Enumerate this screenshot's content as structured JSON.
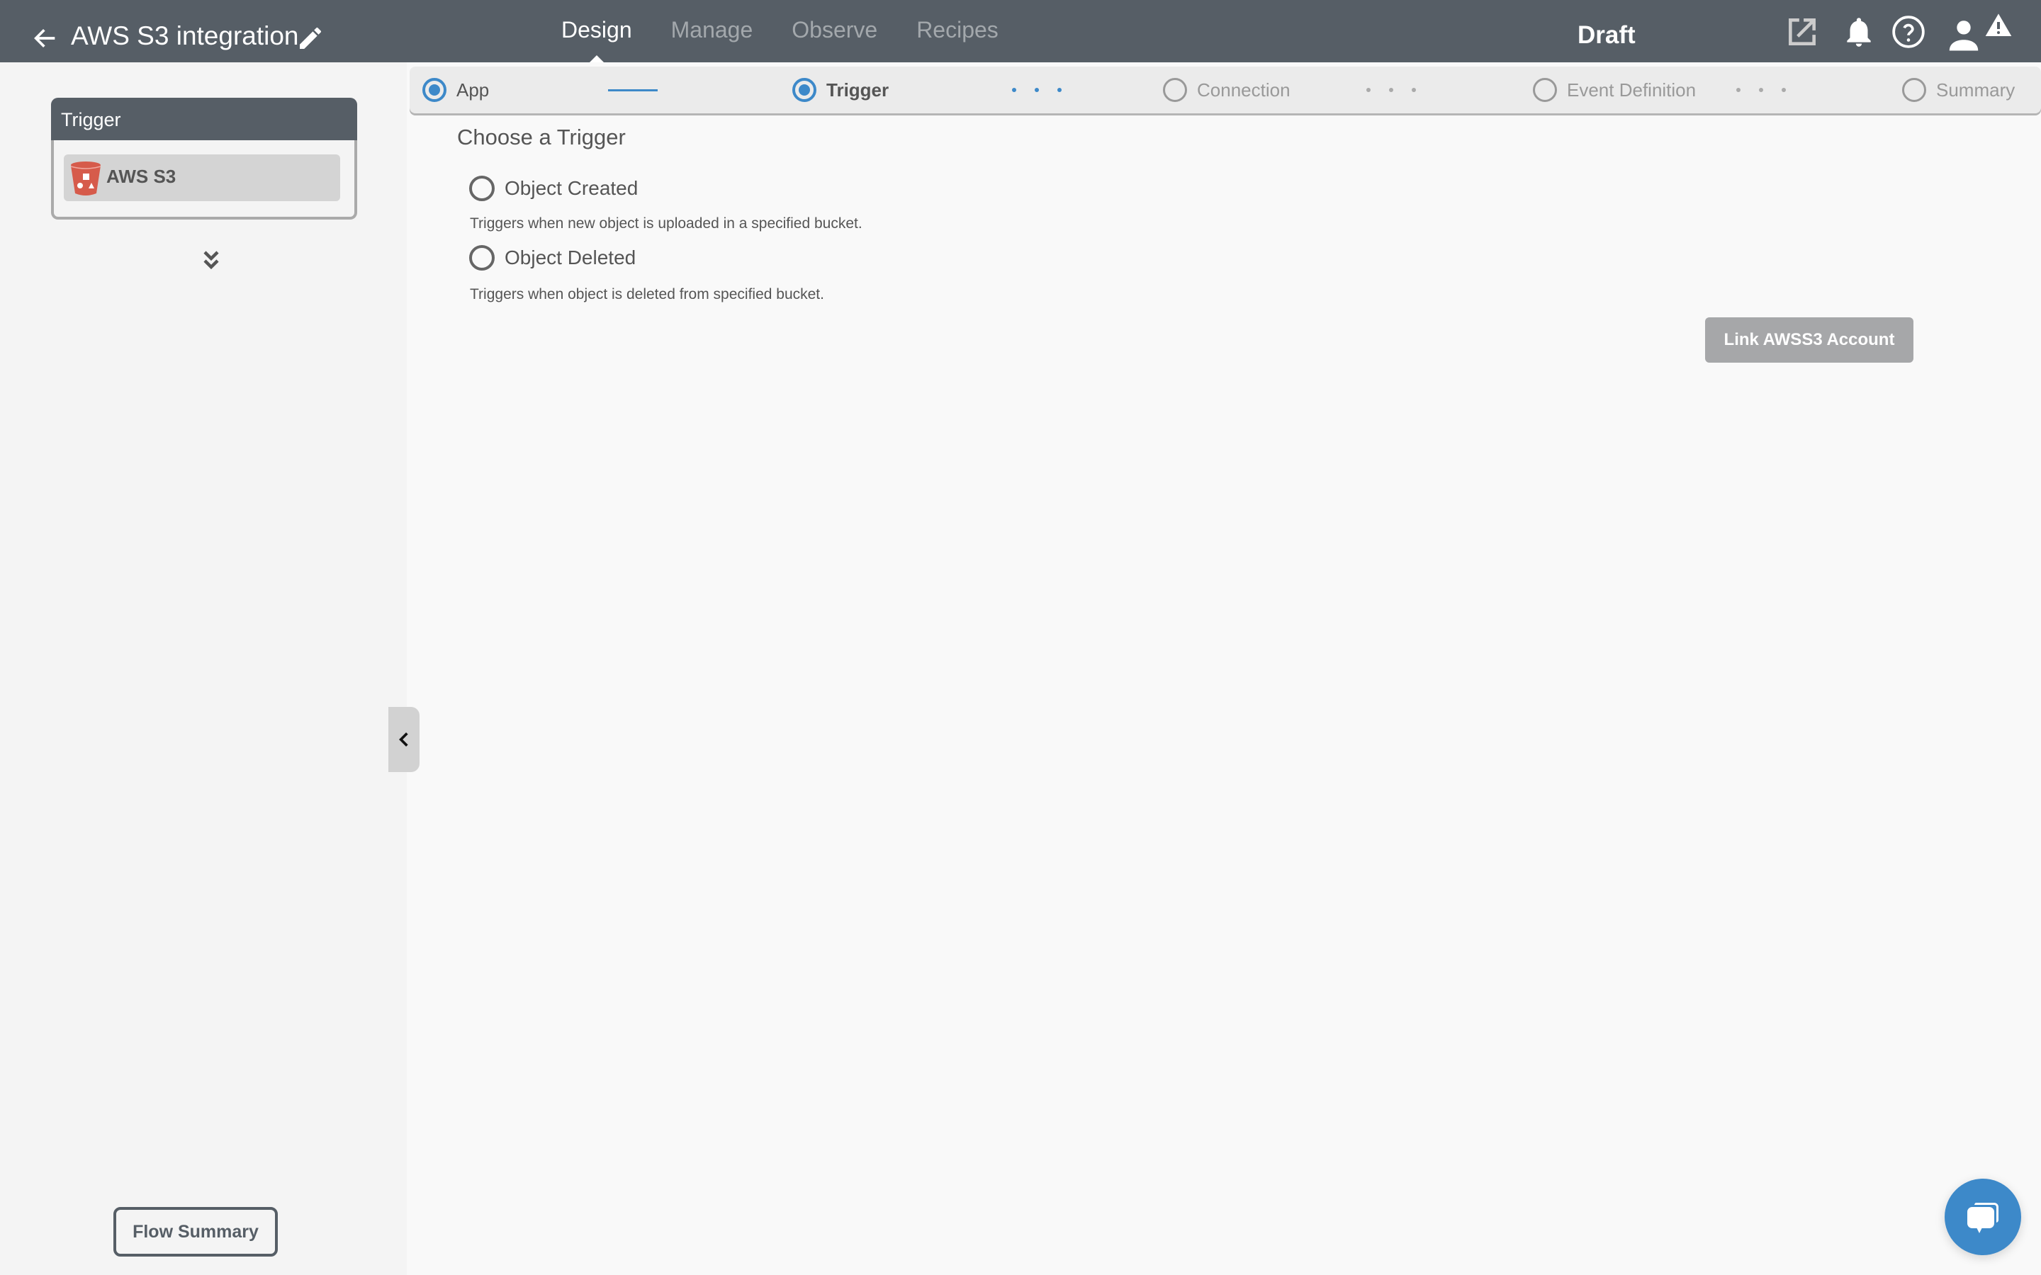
{
  "header": {
    "back_icon": "arrow-left-icon",
    "title": "AWS S3 integration",
    "edit_icon": "pencil-icon",
    "tabs": [
      {
        "label": "Design",
        "active": true
      },
      {
        "label": "Manage",
        "active": false
      },
      {
        "label": "Observe",
        "active": false
      },
      {
        "label": "Recipes",
        "active": false
      }
    ],
    "status": "Draft",
    "icons": [
      "external-link-icon",
      "bell-icon",
      "help-circle-icon",
      "user-icon",
      "warning-icon"
    ]
  },
  "sidebar": {
    "card_title": "Trigger",
    "app_name": "AWS S3",
    "app_icon": "aws-s3-bucket-icon",
    "expand_icon": "double-chevron-down-icon",
    "flow_summary_label": "Flow Summary",
    "collapse_icon": "chevron-left-icon"
  },
  "stepper": {
    "steps": [
      {
        "label": "App",
        "state": "done"
      },
      {
        "label": "Trigger",
        "state": "active"
      },
      {
        "label": "Connection",
        "state": "pending"
      },
      {
        "label": "Event Definition",
        "state": "pending"
      },
      {
        "label": "Summary",
        "state": "pending"
      }
    ]
  },
  "main": {
    "title": "Choose a Trigger",
    "options": [
      {
        "label": "Object Created",
        "description": "Triggers when new object is uploaded in a specified bucket.",
        "selected": false
      },
      {
        "label": "Object Deleted",
        "description": "Triggers when object is deleted from specified bucket.",
        "selected": false
      }
    ],
    "link_button": "Link AWSS3 Account"
  },
  "colors": {
    "header_bg": "#565e66",
    "accent": "#3d89c9",
    "s3_red": "#d65b4b",
    "button_disabled": "#a6a7a9"
  },
  "chat_icon": "chat-bubbles-icon"
}
